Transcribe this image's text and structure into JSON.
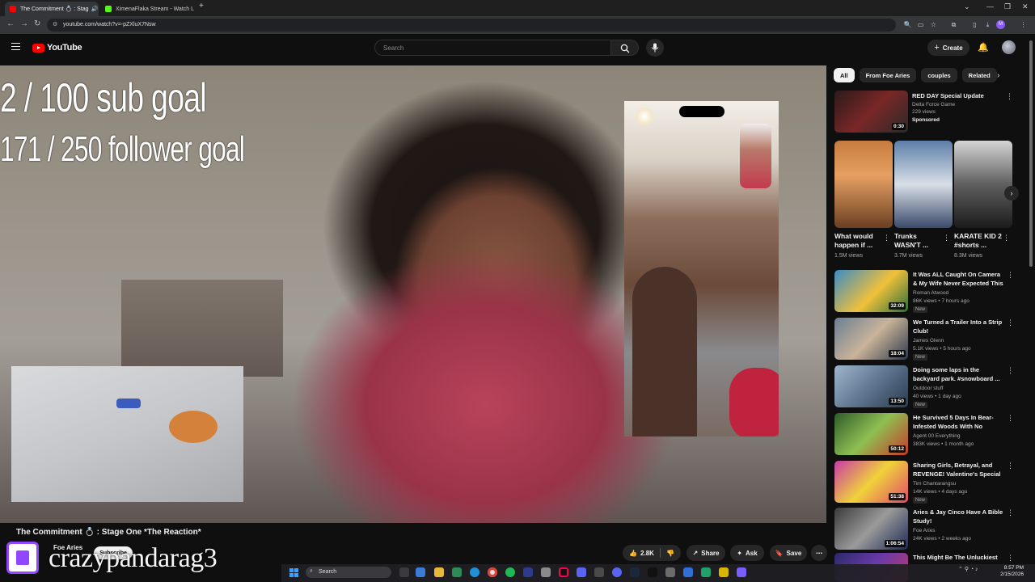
{
  "browser": {
    "tabs": [
      {
        "title": "The Commitment 💍 : Stag",
        "active": true,
        "favicon_color": "#ff0000"
      },
      {
        "title": "XimenaFlaka Stream - Watch L",
        "active": false,
        "favicon_color": "#53fc18"
      }
    ],
    "new_tab": "+",
    "url": "youtube.com/watch?v=-pZXluX7Nsw"
  },
  "youtube": {
    "logo_text": "YouTube",
    "search_placeholder": "Search",
    "create_label": "Create"
  },
  "video": {
    "overlay_sub_goal": "2  / 100 sub goal",
    "overlay_follower_goal": "171 / 250 follower goal",
    "watermark": "crazypandarag3",
    "title": "The Commitment 💍 : Stage One *The Reaction*",
    "channel_name": "Foe Aries",
    "subscribe_label": "Subscribe",
    "likes": "2.8K",
    "share_label": "Share",
    "ask_label": "Ask",
    "save_label": "Save"
  },
  "sidebar": {
    "chips": [
      "All",
      "From Foe Aries",
      "couples",
      "Related"
    ],
    "ad": {
      "title": "RED DAY Special Update",
      "channel": "Delta Force Game",
      "views": "229 views",
      "badge": "Sponsored",
      "duration": "0:30"
    },
    "shorts": [
      {
        "title": "What would happen if ...",
        "views": "1.5M views"
      },
      {
        "title": "Trunks WASN'T ...",
        "views": "3.7M views"
      },
      {
        "title": "KARATE KID 2 #shorts ...",
        "views": "8.3M views"
      }
    ],
    "videos": [
      {
        "title": "It Was ALL Caught On Camera & My Wife Never Expected This ...",
        "channel": "Roman Atwood",
        "meta": "86K views • 7 hours ago",
        "badge": "New",
        "duration": "32:09"
      },
      {
        "title": "We Turned a Trailer Into a Strip Club!",
        "channel": "James Glenn",
        "meta": "5.1K views • 5 hours ago",
        "badge": "New",
        "duration": "18:04"
      },
      {
        "title": "Doing some laps in the backyard park. #snowboard ...",
        "channel": "Outdoor stuff",
        "meta": "40 views • 1 day ago",
        "badge": "New",
        "duration": "13:50"
      },
      {
        "title": "He Survived 5 Days In Bear-Infested Woods With No Water...",
        "channel": "Agent 00 Everything",
        "meta": "383K views • 1 month ago",
        "badge": "",
        "duration": "50:12"
      },
      {
        "title": "Sharing Girls, Betrayal, and REVENGE! Valentine's Special | ...",
        "channel": "Tim Chantarangsu",
        "meta": "14K views • 4 days ago",
        "badge": "New",
        "duration": "51:38"
      },
      {
        "title": "Aries & Jay Cinco Have A Bible Study!",
        "channel": "Foe Aries",
        "meta": "24K views • 2 weeks ago",
        "badge": "",
        "duration": "1:06:54"
      },
      {
        "title": "This Might Be The Unluckiest",
        "channel": "",
        "meta": "",
        "badge": "",
        "duration": ""
      }
    ]
  },
  "taskbar": {
    "search_placeholder": "Search",
    "time": "8:57 PM",
    "date": "2/15/2026"
  }
}
